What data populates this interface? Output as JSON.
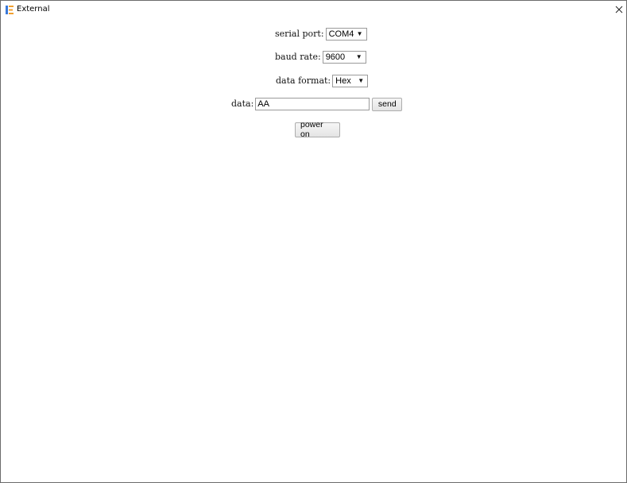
{
  "window": {
    "title": "External",
    "icon": "external-app-icon",
    "close_icon": "close-icon"
  },
  "form": {
    "serial_port": {
      "label": "serial port:",
      "selected": "COM4"
    },
    "baud_rate": {
      "label": "baud rate:",
      "selected": "9600"
    },
    "data_format": {
      "label": "data format:",
      "selected": "Hex"
    },
    "data": {
      "label": "data:",
      "value": "AA"
    },
    "send_label": "send",
    "power_on_label": "power on"
  },
  "colors": {
    "icon_orange": "#f0a030",
    "icon_blue": "#3a78d8"
  }
}
